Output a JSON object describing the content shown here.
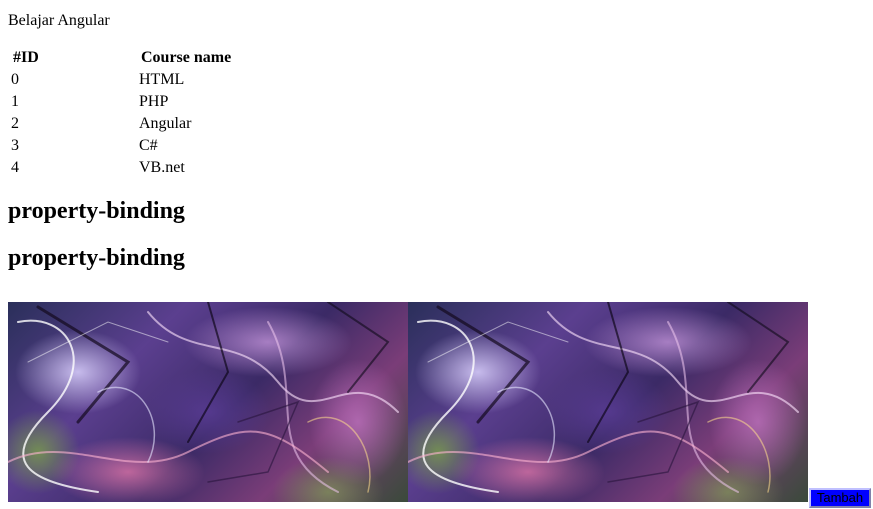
{
  "app": {
    "title": "Belajar Angular"
  },
  "courses_table": {
    "headers": [
      "#ID",
      "Course name"
    ],
    "rows": [
      {
        "id": "0",
        "name": "HTML"
      },
      {
        "id": "1",
        "name": "PHP"
      },
      {
        "id": "2",
        "name": "Angular"
      },
      {
        "id": "3",
        "name": "C#"
      },
      {
        "id": "4",
        "name": "VB.net"
      }
    ]
  },
  "headings": {
    "first": "property-binding",
    "second": "property-binding"
  },
  "images": [
    {
      "name": "abstract-art-image"
    },
    {
      "name": "abstract-art-image"
    }
  ],
  "actions": {
    "add_label": "Tambah",
    "add_color": "#0000ff"
  }
}
